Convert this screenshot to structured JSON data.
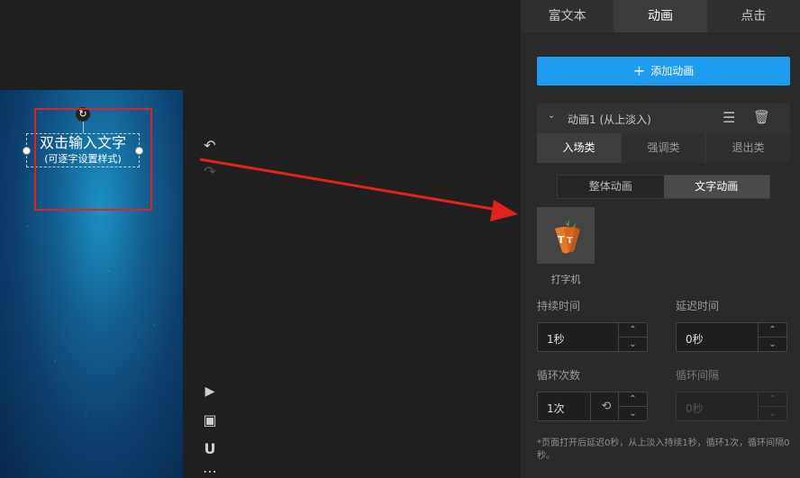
{
  "canvas": {
    "line1": "双击输入文字",
    "line2": "(可逐字设置样式)",
    "rotate_glyph": "↻"
  },
  "toolbar": {
    "undo_glyph": "↶",
    "redo_glyph": "↷",
    "play_glyph": "▶",
    "frame_glyph": "▣",
    "magnet_glyph": "U",
    "more_glyph": "⋯"
  },
  "panel": {
    "tabs": [
      {
        "label": "富文本"
      },
      {
        "label": "动画"
      },
      {
        "label": "点击"
      }
    ],
    "add_button": {
      "icon": "+",
      "label": "添加动画"
    },
    "animation": {
      "chevron": "⌄",
      "name": "动画1 (从上淡入)",
      "menu_glyph": "☰",
      "trash_glyph": "🗑"
    },
    "subtabs": [
      {
        "label": "入场类"
      },
      {
        "label": "强调类"
      },
      {
        "label": "退出类"
      }
    ],
    "mode_toggle": [
      {
        "label": "整体动画"
      },
      {
        "label": "文字动画"
      }
    ],
    "effect": {
      "label": "打字机",
      "icon_text": "T"
    },
    "duration": {
      "label": "持续时间",
      "value": "1秒"
    },
    "delay": {
      "label": "延迟时间",
      "value": "0秒"
    },
    "loop_count": {
      "label": "循环次数",
      "value": "1次",
      "loop_glyph": "⟲"
    },
    "loop_interval": {
      "label": "循环间隔",
      "value": "0秒"
    },
    "spin_up": "⌃",
    "spin_down": "⌄",
    "note": "*页面打开后延迟0秒，从上淡入持续1秒，循环1次，循环间隔0秒。"
  }
}
